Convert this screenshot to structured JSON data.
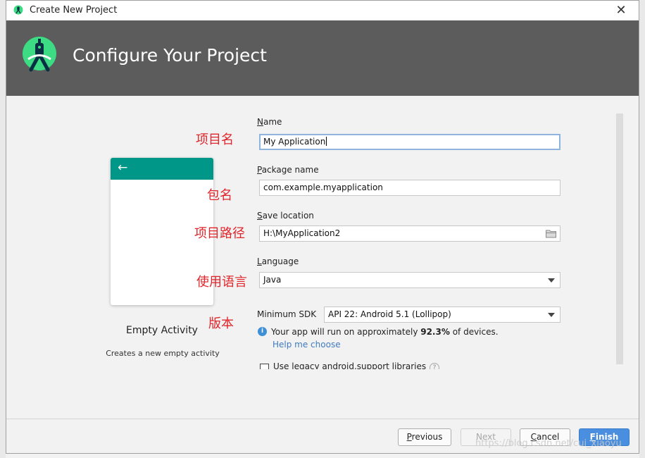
{
  "window": {
    "title": "Create New Project"
  },
  "header": {
    "title": "Configure Your Project"
  },
  "preview": {
    "activity_name": "Empty Activity",
    "activity_desc": "Creates a new empty activity"
  },
  "form": {
    "name": {
      "label_key": "N",
      "label_rest": "ame",
      "value": "My Application"
    },
    "package": {
      "label_key": "P",
      "label_rest": "ackage name",
      "value": "com.example.myapplication"
    },
    "save_location": {
      "label_key": "S",
      "label_rest": "ave location",
      "value": "H:\\MyApplication2"
    },
    "language": {
      "label_key": "L",
      "label_rest": "anguage",
      "value": "Java"
    },
    "min_sdk": {
      "label": "Minimum SDK",
      "value": "API 22: Android 5.1 (Lollipop)"
    },
    "info": {
      "prefix": "Your app will run on approximately ",
      "percent": "92.3%",
      "suffix": " of devices."
    },
    "help_link": "Help me choose",
    "legacy_checkbox": {
      "label": "Use legacy android.support libraries",
      "checked": false
    }
  },
  "buttons": {
    "previous_key": "P",
    "previous_rest": "revious",
    "next": "Next",
    "cancel_key": "C",
    "cancel_rest": "ancel",
    "finish_key": "F",
    "finish_rest": "inish"
  },
  "annotations": {
    "project_name": "项目名",
    "package_name": "包名",
    "project_path": "项目路径",
    "language": "使用语言",
    "version": "版本"
  },
  "watermark": "https://blog.csdn.net/cui_xiaoyu",
  "colors": {
    "header_bg": "#5c5c5c",
    "accent_teal": "#009688",
    "primary_button": "#4a8edf",
    "annotation_red": "#e0262b",
    "link": "#3f7bc0"
  },
  "icons": [
    "android-studio-icon",
    "close-icon",
    "back-arrow-icon",
    "folder-icon",
    "dropdown-arrow-icon",
    "info-icon",
    "help-icon"
  ]
}
